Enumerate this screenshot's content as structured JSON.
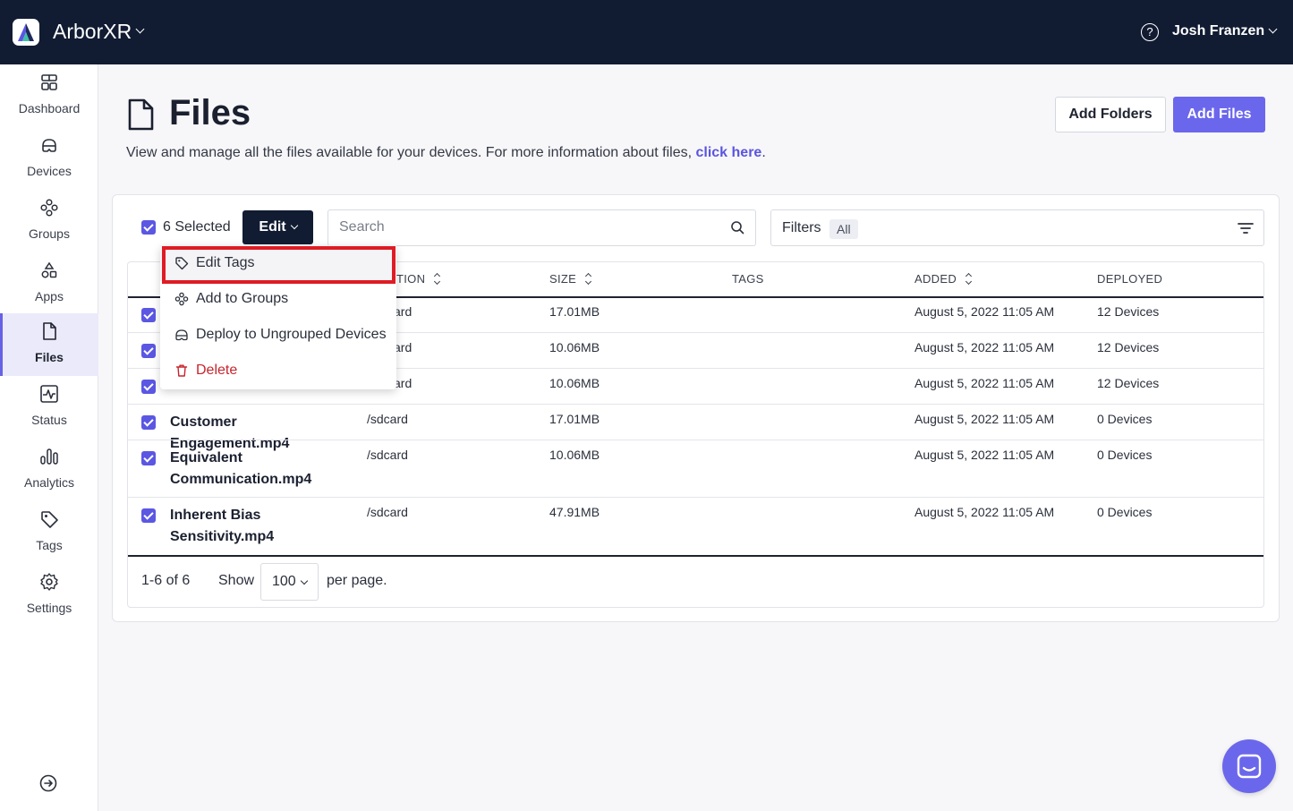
{
  "app": {
    "name": "ArborXR"
  },
  "user": {
    "name": "Josh Franzen"
  },
  "sidebar": {
    "items": [
      {
        "label": "Dashboard",
        "icon": "dashboard-icon"
      },
      {
        "label": "Devices",
        "icon": "headset-icon"
      },
      {
        "label": "Groups",
        "icon": "groups-icon"
      },
      {
        "label": "Apps",
        "icon": "apps-icon"
      },
      {
        "label": "Files",
        "icon": "file-icon",
        "active": true
      },
      {
        "label": "Status",
        "icon": "status-icon"
      },
      {
        "label": "Analytics",
        "icon": "analytics-icon"
      },
      {
        "label": "Tags",
        "icon": "tag-icon"
      },
      {
        "label": "Settings",
        "icon": "gear-icon"
      }
    ]
  },
  "header": {
    "title": "Files",
    "description": "View and manage all the files available for your devices. For more information about files, ",
    "link_text": "click here",
    "description_end": ".",
    "add_folders_label": "Add Folders",
    "add_files_label": "Add Files"
  },
  "toolbar": {
    "selected_label": "6 Selected",
    "edit_label": "Edit",
    "search_placeholder": "Search",
    "filters_label": "Filters",
    "filters_value": "All"
  },
  "menu": {
    "items": [
      {
        "label": "Edit Tags",
        "icon": "tag-icon"
      },
      {
        "label": "Add to Groups",
        "icon": "groups-icon"
      },
      {
        "label": "Deploy to Ungrouped Devices",
        "icon": "headset-icon"
      },
      {
        "label": "Delete",
        "icon": "trash-icon",
        "danger": true
      }
    ]
  },
  "table": {
    "columns": [
      "TION",
      "SIZE",
      "TAGS",
      "ADDED",
      "DEPLOYED"
    ],
    "rows": [
      {
        "name": "",
        "location": "ard",
        "size": "17.01MB",
        "tags": "",
        "added": "August 5, 2022 11:05 AM",
        "deployed": "12 Devices"
      },
      {
        "name": "",
        "location": "ard",
        "size": "10.06MB",
        "tags": "",
        "added": "August 5, 2022 11:05 AM",
        "deployed": "12 Devices"
      },
      {
        "name": "",
        "location": "ard",
        "size": "10.06MB",
        "tags": "",
        "added": "August 5, 2022 11:05 AM",
        "deployed": "12 Devices"
      },
      {
        "name": "Customer Engagement.mp4",
        "location": "/sdcard",
        "size": "17.01MB",
        "tags": "",
        "added": "August 5, 2022 11:05 AM",
        "deployed": "0 Devices"
      },
      {
        "name": "Equivalent Communication.mp4",
        "location": "/sdcard",
        "size": "10.06MB",
        "tags": "",
        "added": "August 5, 2022 11:05 AM",
        "deployed": "0 Devices"
      },
      {
        "name": "Inherent Bias Sensitivity.mp4",
        "location": "/sdcard",
        "size": "47.91MB",
        "tags": "",
        "added": "August 5, 2022 11:05 AM",
        "deployed": "0 Devices"
      }
    ]
  },
  "pagination": {
    "count": "1-6 of 6",
    "show_label": "Show",
    "per_page_value": "100",
    "per_page_label": "per page."
  },
  "colors": {
    "topbar": "#111c33",
    "accent": "#6b67ec",
    "danger": "#c8242c",
    "highlight_box": "#e01b24"
  }
}
